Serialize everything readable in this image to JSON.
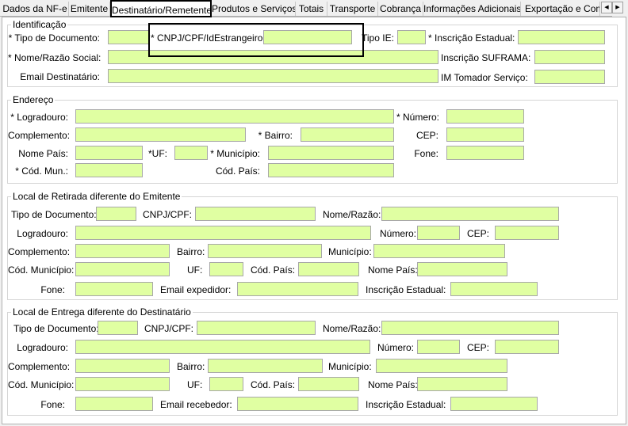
{
  "tabs": [
    "Dados da NF-e",
    "Emitente",
    "Destinatário/Remetente",
    "Produtos e Serviços",
    "Totais",
    "Transporte",
    "Cobrança",
    "Informações Adicionais",
    "Exportação e Compra"
  ],
  "scroll": {
    "left": "◀",
    "right": "▶"
  },
  "identificacao": {
    "title": "Identificação",
    "tipo_doc": "* Tipo de Documento:",
    "cnpj": "* CNPJ/CPF/IdEstrangeiro:",
    "tipo_ie": "Tipo IE:",
    "insc_estadual": "* Inscrição Estadual:",
    "nome": "* Nome/Razão Social:",
    "insc_suframa": "Inscrição SUFRAMA:",
    "email": "Email Destinatário:",
    "im_tomador": "IM Tomador Serviço:"
  },
  "endereco": {
    "title": "Endereço",
    "logradouro": "* Logradouro:",
    "numero": "* Número:",
    "complemento": "Complemento:",
    "bairro": "* Bairro:",
    "cep": "CEP:",
    "nome_pais": "Nome País:",
    "uf": "*UF:",
    "municipio": "* Município:",
    "fone": "Fone:",
    "cod_mun": "* Cód. Mun.:",
    "cod_pais": "Cód. País:"
  },
  "retirada": {
    "title": "Local de Retirada diferente do Emitente",
    "tipo_doc": "Tipo de Documento:",
    "cnpj": "CNPJ/CPF:",
    "nome": "Nome/Razão:",
    "logradouro": "Logradouro:",
    "numero": "Número:",
    "cep": "CEP:",
    "complemento": "Complemento:",
    "bairro": "Bairro:",
    "municipio": "Município:",
    "cod_municipio": "Cód. Município:",
    "uf": "UF:",
    "cod_pais": "Cód. País:",
    "nome_pais": "Nome País:",
    "fone": "Fone:",
    "email": "Email expedidor:",
    "insc_estadual": "Inscrição Estadual:"
  },
  "entrega": {
    "title": "Local de Entrega diferente do Destinatário",
    "tipo_doc": "Tipo de Documento:",
    "cnpj": "CNPJ/CPF:",
    "nome": "Nome/Razão:",
    "logradouro": "Logradouro:",
    "numero": "Número:",
    "cep": "CEP:",
    "complemento": "Complemento:",
    "bairro": "Bairro:",
    "municipio": "Município:",
    "cod_municipio": "Cód. Município:",
    "uf": "UF:",
    "cod_pais": "Cód. País:",
    "nome_pais": "Nome País:",
    "fone": "Fone:",
    "email": "Email recebedor:",
    "insc_estadual": "Inscrição Estadual:"
  },
  "colors": {
    "field": "#e0ffa2",
    "panel": "#ffffff",
    "highlight": "#000000"
  }
}
